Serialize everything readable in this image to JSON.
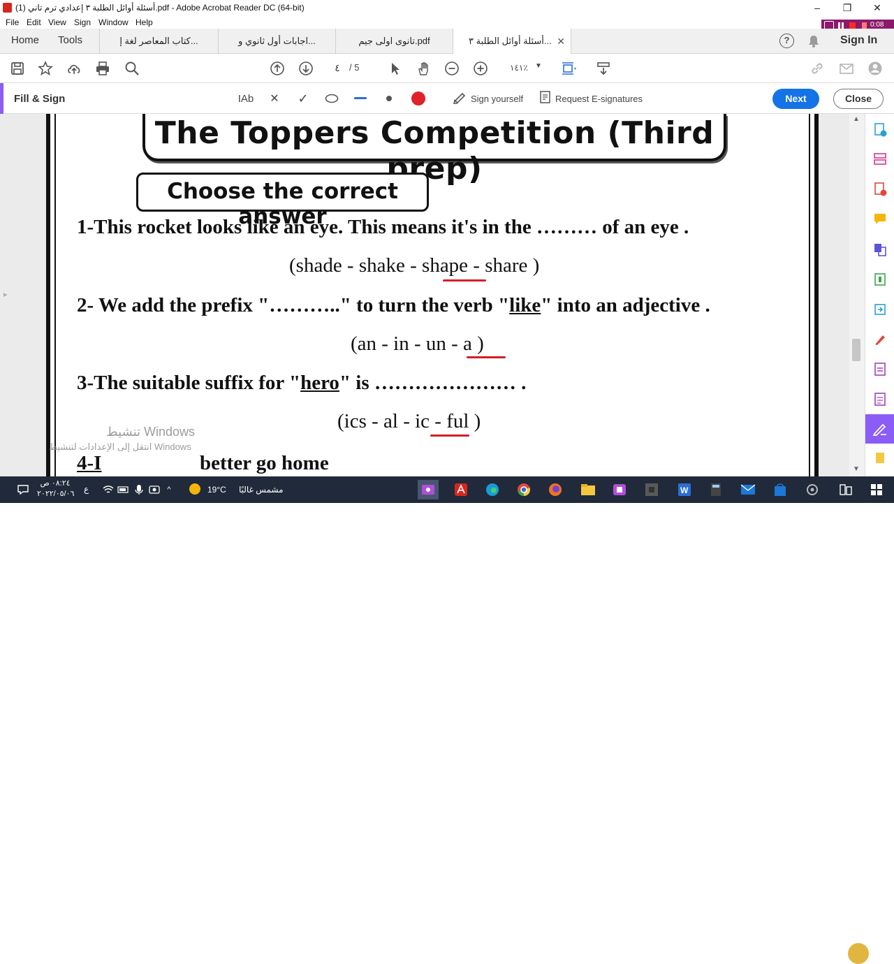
{
  "window": {
    "title": "أسئلة أوائل الطلبة ٣ إعدادي ترم تاني (1).pdf - Adobe Acrobat Reader DC (64-bit)",
    "minimize": "–",
    "maximize": "❐",
    "close": "✕"
  },
  "recorder": {
    "time": "0:08"
  },
  "menu": [
    "File",
    "Edit",
    "View",
    "Sign",
    "Window",
    "Help"
  ],
  "nav_tabs": {
    "home": "Home",
    "tools": "Tools"
  },
  "doc_tabs": [
    {
      "label": "كتاب المعاصر لغة إ..."
    },
    {
      "label": "اجابات أول ثانوي و..."
    },
    {
      "label": "تانوى اولى جيم.pdf"
    },
    {
      "label": "أسئلة أوائل الطلبة ٣...",
      "active": true
    }
  ],
  "header_right": {
    "help_icon": "?",
    "sign_in": "Sign In"
  },
  "toolbar": {
    "page_current": "٤",
    "page_total": "/ 5",
    "zoom": "١٤١٪"
  },
  "fill_sign": {
    "label": "Fill & Sign",
    "text_tool": "IAb",
    "cross_tool": "✕",
    "check_tool": "✓",
    "sign_yourself": "Sign yourself",
    "request_esign": "Request E-signatures",
    "next": "Next",
    "close": "Close",
    "color": "#e0202a"
  },
  "document": {
    "title": "The Toppers Competition (Third prep)",
    "subtitle": "Choose the correct answer",
    "questions": [
      {
        "pre": "1-This rocket looks like an eye. This means it's in the ……… of an eye .",
        "options": "(shade - shake - shape - share )"
      },
      {
        "pre": "2- We add the  prefix \"………..\" to turn  the verb \"",
        "key": "like",
        "post": "\" into an adjective .",
        "options": "(an - in - un - a )"
      },
      {
        "pre": "3-The suitable suffix for \"",
        "key": "hero",
        "post": "\" is ………………… .",
        "options": "(ics  - al -  ic  - ful )"
      },
      {
        "pre": "4-I",
        "post": "better go home"
      }
    ],
    "watermark_line1": "تنشيط Windows",
    "watermark_line2": "انتقل إلى الإعدادات لتنشيط Windows"
  },
  "taskbar": {
    "weather_temp": "19°C",
    "weather_text": "مشمس غالبًا",
    "time": "٠٨:٢٤ ص",
    "date": "٢٠٢٢/٠٥/٠٦",
    "lang": "ع"
  }
}
